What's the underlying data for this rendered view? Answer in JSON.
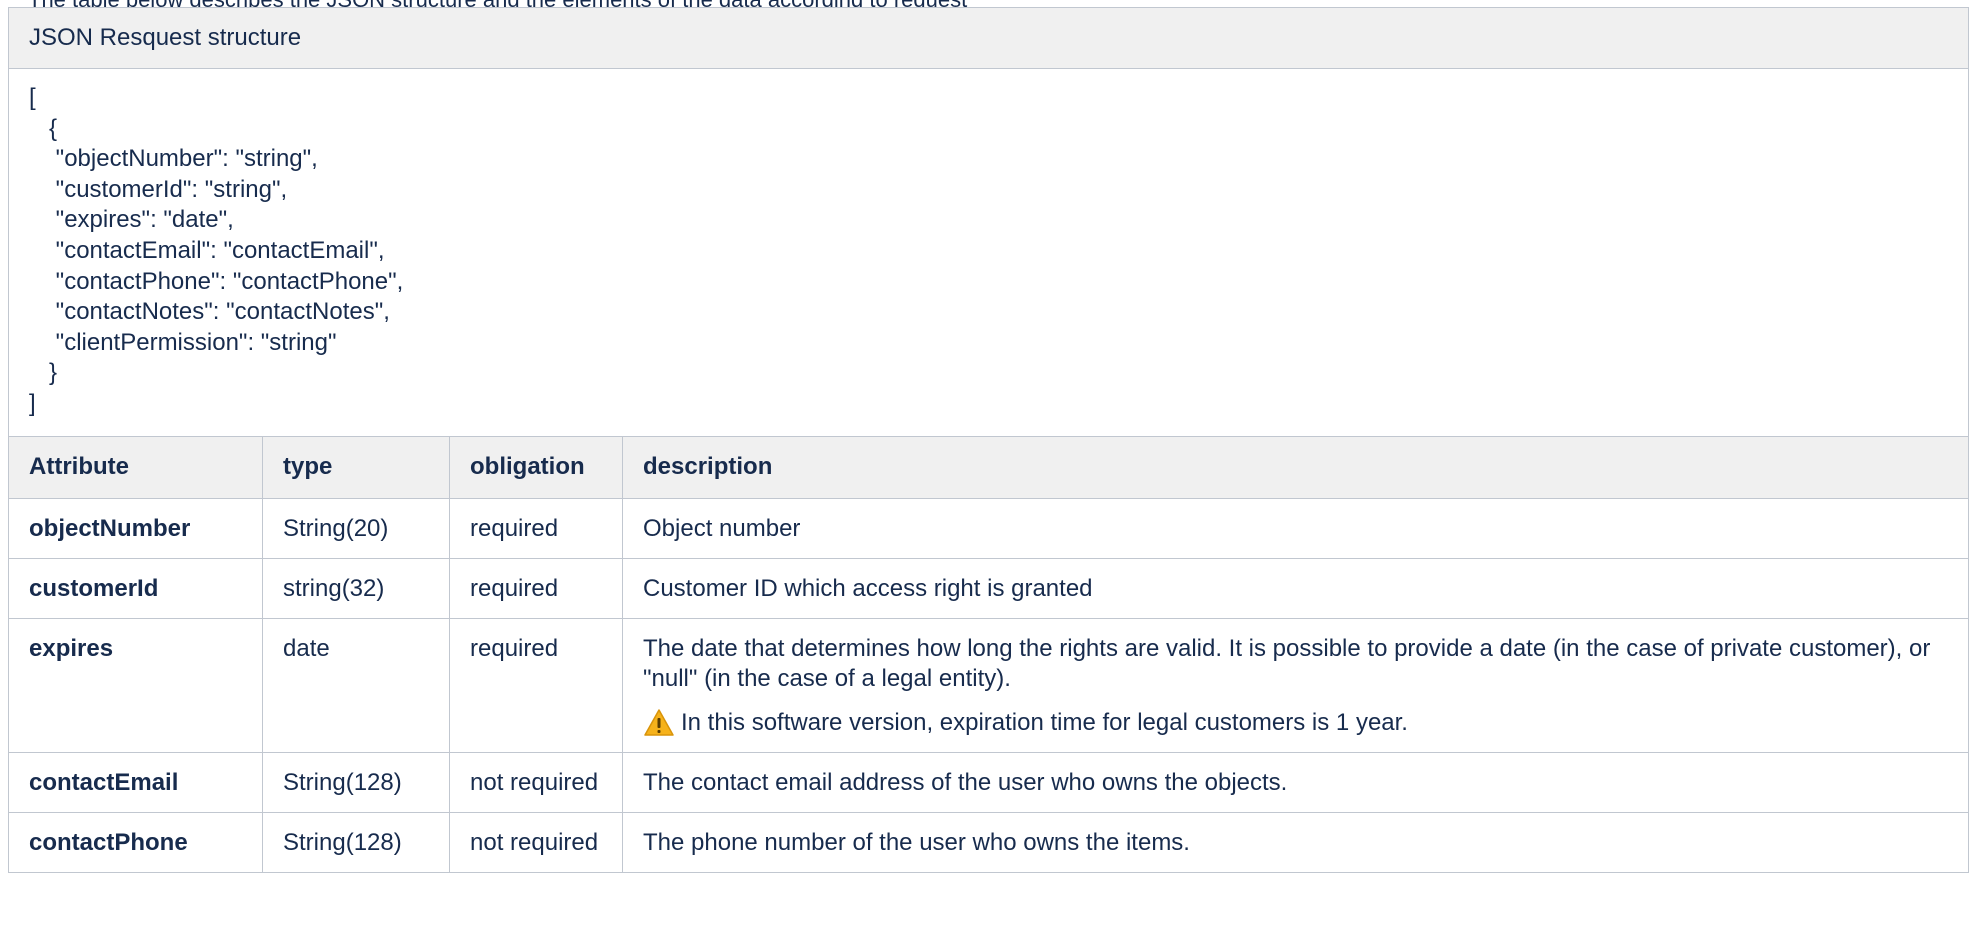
{
  "intro_text": "The table below describes the JSON structure and the elements of the data according to request",
  "json_panel": {
    "title": "JSON Resquest structure",
    "lines": [
      "[",
      "   {",
      "    \"objectNumber\": \"string\",",
      "    \"customerId\": \"string\",",
      "    \"expires\": \"date\",",
      "    \"contactEmail\": \"contactEmail\",",
      "    \"contactPhone\": \"contactPhone\",",
      "    \"contactNotes\": \"contactNotes\",",
      "    \"clientPermission\": \"string\"",
      "   }",
      "]"
    ]
  },
  "table": {
    "headers": [
      "Attribute",
      "type",
      "obligation",
      "description"
    ],
    "rows": [
      {
        "attribute": "objectNumber",
        "type": "String(20)",
        "obligation": "required",
        "description": "Object number",
        "note": ""
      },
      {
        "attribute": "customerId",
        "type": "string(32)",
        "obligation": "required",
        "description": "Customer ID which access right is granted",
        "note": ""
      },
      {
        "attribute": "expires",
        "type": "date",
        "obligation": "required",
        "description": "The date that determines how long the rights are valid. It is possible to provide a date (in the case of private customer), or \"null\" (in the case of a legal entity).",
        "note": "In this software version, expiration time for legal customers is 1 year."
      },
      {
        "attribute": "contactEmail",
        "type": "String(128)",
        "obligation": "not required",
        "description": "The contact email address of the user who owns the objects.",
        "note": ""
      },
      {
        "attribute": "contactPhone",
        "type": "String(128)",
        "obligation": "not required",
        "description": "The phone number of the user who owns the items.",
        "note": ""
      }
    ]
  },
  "colors": {
    "text": "#172b4d",
    "header_bg": "#f0f0f0",
    "border": "#c1c7d0",
    "warning_fill": "#f6b21b"
  },
  "icons": {
    "warning": "warning-triangle-icon"
  }
}
